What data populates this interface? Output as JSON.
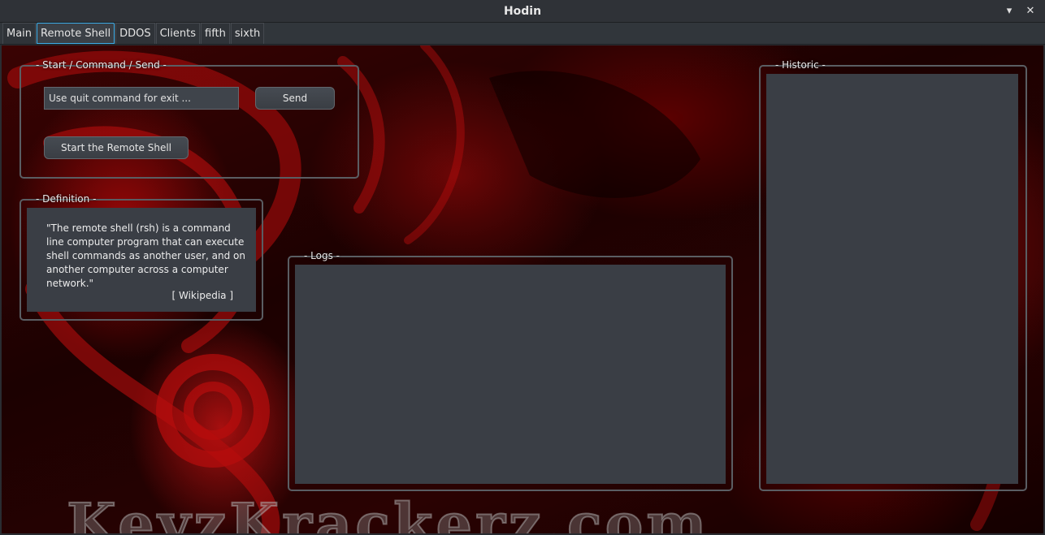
{
  "window": {
    "title": "Hodin",
    "minimize_glyph": "▾",
    "close_glyph": "✕"
  },
  "tabs": [
    {
      "label": "Main",
      "active": false
    },
    {
      "label": "Remote Shell",
      "active": true
    },
    {
      "label": "DDOS",
      "active": false
    },
    {
      "label": "Clients",
      "active": false
    },
    {
      "label": "fifth",
      "active": false
    },
    {
      "label": "sixth",
      "active": false
    }
  ],
  "command_group": {
    "title": "- Start / Command / Send -",
    "input_placeholder": "Use quit command for exit ...",
    "send_label": "Send",
    "start_label": "Start the Remote Shell"
  },
  "definition_group": {
    "title": "- Definition -",
    "text": "\"The remote shell (rsh) is a command line computer program that can execute shell commands as another user, and on another computer across a computer network.\"",
    "source": "[ Wikipedia ]"
  },
  "logs_group": {
    "title": "- Logs -"
  },
  "historic_group": {
    "title": "- Historic -"
  },
  "background": {
    "watermark": "KeyzKrackerz.com",
    "accent_red": "#c41010"
  },
  "colors": {
    "panel": "#3a3e45",
    "tab_highlight": "#3daee9"
  }
}
